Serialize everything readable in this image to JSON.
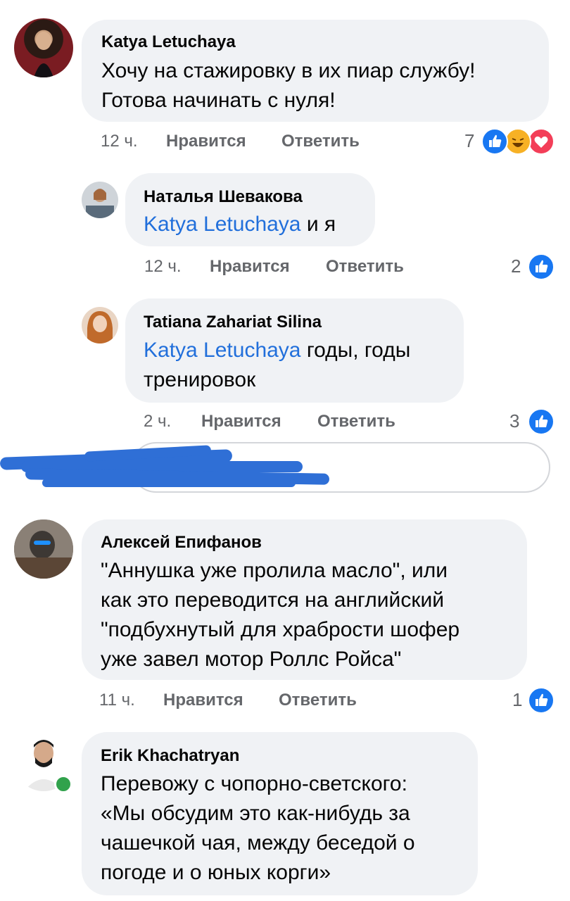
{
  "comments": [
    {
      "author": "Katya Letuchaya",
      "lines": [
        "Хочу на стажировку в их пиар службу!",
        "Готова начинать с нуля!"
      ],
      "time": "12 ч.",
      "like_label": "Нравится",
      "reply_label": "Ответить",
      "reaction_count": "7",
      "reactions": [
        "like-icon",
        "haha-icon",
        "love-icon"
      ]
    },
    {
      "author": "Наталья Шевакова",
      "mention": "Katya Letuchaya",
      "text_after_mention": " и я",
      "time": "12 ч.",
      "like_label": "Нравится",
      "reply_label": "Ответить",
      "reaction_count": "2",
      "reactions": [
        "like-icon"
      ]
    },
    {
      "author": "Tatiana Zahariat Silina",
      "mention": "Katya Letuchaya",
      "text_after_mention": " годы, годы",
      "line2": "тренировок",
      "time": "2 ч.",
      "like_label": "Нравится",
      "reply_label": "Ответить",
      "reaction_count": "3",
      "reactions": [
        "like-icon"
      ]
    },
    {
      "author": "Алексей Епифанов",
      "lines": [
        "\"Аннушка уже пролила масло\", или",
        "как это переводится на английский",
        "\"подбухнутый для храбрости шофер",
        "уже завел мотор Роллс Ройса\""
      ],
      "time": "11 ч.",
      "like_label": "Нравится",
      "reply_label": "Ответить",
      "reaction_count": "1",
      "reactions": [
        "like-icon"
      ]
    },
    {
      "author": "Erik Khachatryan",
      "lines": [
        "Перевожу с чопорно-светского:",
        "«Мы обсудим это как-нибудь за",
        "чашечкой чая, между беседой о",
        "погоде и о юных корги»"
      ]
    }
  ],
  "colors": {
    "bubble": "#f0f2f5",
    "mention": "#216fdb",
    "meta": "#65676b",
    "like": "#1877f2",
    "haha": "#f7b125",
    "love": "#f33e58",
    "online": "#31a24c"
  }
}
